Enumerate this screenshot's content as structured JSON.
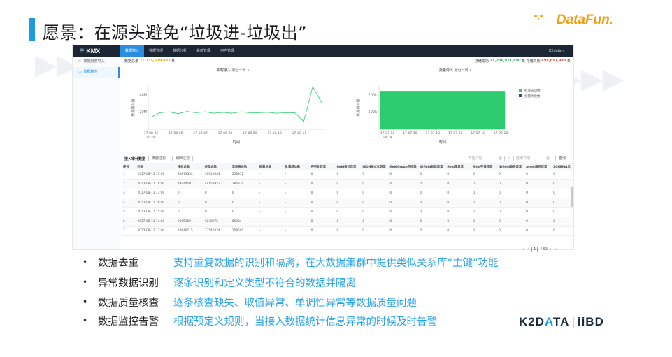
{
  "slide": {
    "title": "愿景：在源头避免“垃圾进-垃圾出”",
    "brand": "DataFun.",
    "brand_dots": "•:•",
    "footer_logo_left": "K2D",
    "footer_logo_a": "A",
    "footer_logo_mid": "TA",
    "footer_logo_sep": "|",
    "footer_logo_right": "iiBD",
    "accent_color": "#1e9be0"
  },
  "app": {
    "logo": "KMX",
    "nav": [
      "数据接入",
      "数据管理",
      "数据分析",
      "系统管理",
      "用户管理"
    ],
    "active_nav": 0,
    "user": "K2data ∨",
    "sidebar": [
      {
        "label": "数据批量导入",
        "icon": "list-icon"
      },
      {
        "label": "数据稽查",
        "icon": "monitor-icon",
        "active": true
      }
    ],
    "stats": {
      "total_label": "数据总量",
      "total_value": "21,735,579,883",
      "total_unit": "条",
      "stored_label": "存储成功",
      "stored_value": "21,236,921,890",
      "stored_unit": "条",
      "failed_label": "存储失败",
      "failed_value": "498,657,993",
      "failed_unit": "条"
    },
    "left_chart_title": "实时接入",
    "left_chart_range": "最近一周 ∨",
    "right_chart_title": "批量导入",
    "right_chart_range": "最近一周 ∨",
    "table_title": "接入审计数据",
    "filter_btn_1": "摘要过滤",
    "filter_btn_2": "明细过滤",
    "date_start": "开始日期",
    "date_end": "结束日期",
    "date_sep": "~",
    "search_btn": "查询",
    "columns": [
      "序号",
      "时间",
      "接收总数",
      "存储总数",
      "实际接收数",
      "批量总数",
      "批量成功数",
      "序列化异常",
      "field格式异常",
      "JSON格式化异常",
      "fieldGroup空检验",
      "IDfield标记异常",
      "field值异常",
      "field空值异常",
      "IDfield缺失异常",
      "asset服务异常",
      "SCHEMA元"
    ],
    "rows": [
      [
        "1",
        "2017-08-11 19:00",
        "30873354",
        "30610041",
        "253812",
        "-",
        "-",
        "0",
        "0",
        "0",
        "0",
        "0",
        "0",
        "0",
        "0",
        "0",
        "0"
      ],
      [
        "2",
        "2017-08-11 18:00",
        "49444507",
        "49157923",
        "286834",
        "-",
        "-",
        "0",
        "0",
        "0",
        "0",
        "0",
        "0",
        "0",
        "0",
        "0",
        "0"
      ],
      [
        "3",
        "2017-08-11 17:00",
        "0",
        "0",
        "0",
        "-",
        "-",
        "0",
        "0",
        "0",
        "0",
        "0",
        "0",
        "0",
        "0",
        "0",
        "0"
      ],
      [
        "4",
        "2017-08-11 16:00",
        "0",
        "0",
        "0",
        "-",
        "-",
        "0",
        "0",
        "0",
        "0",
        "0",
        "0",
        "0",
        "0",
        "0",
        "0"
      ],
      [
        "5",
        "2017-08-11 15:00",
        "0",
        "0",
        "0",
        "-",
        "-",
        "0",
        "0",
        "0",
        "0",
        "0",
        "0",
        "0",
        "0",
        "0",
        "0"
      ],
      [
        "6",
        "2017-08-11 14:00",
        "9305309",
        "9238975",
        "66334",
        "-",
        "-",
        "0",
        "0",
        "0",
        "0",
        "0",
        "0",
        "0",
        "0",
        "0",
        "0"
      ],
      [
        "7",
        "2017-08-11 13:00",
        "13649115",
        "13540424",
        "108691",
        "-",
        "-",
        "0",
        "0",
        "0",
        "0",
        "0",
        "0",
        "0",
        "0",
        "0",
        "0"
      ]
    ],
    "pager": {
      "first": "«",
      "prev": "‹",
      "current": "1",
      "total": "/ 63",
      "next": "›",
      "last": "»"
    }
  },
  "chart_data": [
    {
      "type": "line",
      "title": "实时接入",
      "xlabel": "时间",
      "ylabel": "数据接入量",
      "ytick_labels": [
        "20M",
        "40M"
      ],
      "xtick_labels": [
        "17-08-05 00:00",
        "17-08-06",
        "17-08-07",
        "17-08-08",
        "17-08-09",
        "17-08-10",
        "17-08-11"
      ],
      "ylim": [
        0,
        50000000
      ],
      "x": [
        "17-08-05 00:00",
        "17-08-05 06:00",
        "17-08-05 12:00",
        "17-08-05 18:00",
        "17-08-06 00:00",
        "17-08-06 12:00",
        "17-08-07 00:00",
        "17-08-07 12:00",
        "17-08-08 00:00",
        "17-08-08 12:00",
        "17-08-09 00:00",
        "17-08-09 12:00",
        "17-08-10 00:00",
        "17-08-10 12:00",
        "17-08-11 00:00",
        "17-08-11 06:00",
        "17-08-11 12:00",
        "17-08-11 15:00",
        "17-08-11 18:00",
        "17-08-11 19:00"
      ],
      "values": [
        14000000,
        19000000,
        20000000,
        18000000,
        20500000,
        19000000,
        20000000,
        18500000,
        19500000,
        18500000,
        20000000,
        19000000,
        19000000,
        19500000,
        18500000,
        19000000,
        19000000,
        9000000,
        49000000,
        31000000
      ],
      "color": "#2ecc71"
    },
    {
      "type": "area",
      "title": "批量导入",
      "xlabel": "时间",
      "ylabel": "数据接入量",
      "ytick_labels": [
        "100k",
        "200k"
      ],
      "xtick_labels": [
        "17-07-18 18:29",
        "17-07-18",
        "17-07-18",
        "17-07-18",
        "17-07-18",
        "17-07-18"
      ],
      "ylim": [
        0,
        250000
      ],
      "x": [
        "17-07-18 18:29",
        "17-07-18 18:30",
        "17-07-18 18:31",
        "17-07-18 18:32",
        "17-07-18 18:33",
        "17-07-18 18:34"
      ],
      "values": [
        220000,
        220000,
        220000,
        220000,
        220000,
        220000
      ],
      "series": [
        {
          "name": "批量成功数",
          "color": "#2ecc71",
          "values": [
            220000,
            220000,
            220000,
            220000,
            220000,
            220000
          ]
        },
        {
          "name": "批量失败数",
          "color": "#2e4a80",
          "values": [
            0,
            0,
            0,
            0,
            0,
            0
          ]
        }
      ],
      "legend": "right"
    }
  ],
  "bullets": [
    {
      "key": "数据去重",
      "desc": "支持重复数据的识别和隔离，在大数据集群中提供类似关系库“主键“功能"
    },
    {
      "key": "异常数据识别",
      "desc": "逐条识别和定义类型不符合的数据并隔离"
    },
    {
      "key": "数据质量核查",
      "desc": "逐条核查缺失、取值异常、单调性异常等数据质量问题"
    },
    {
      "key": "数据监控告警",
      "desc": "根据预定义规则，当接入数据统计信息异常的时候及时告警"
    }
  ],
  "bullet_color": "#2aa3e8"
}
